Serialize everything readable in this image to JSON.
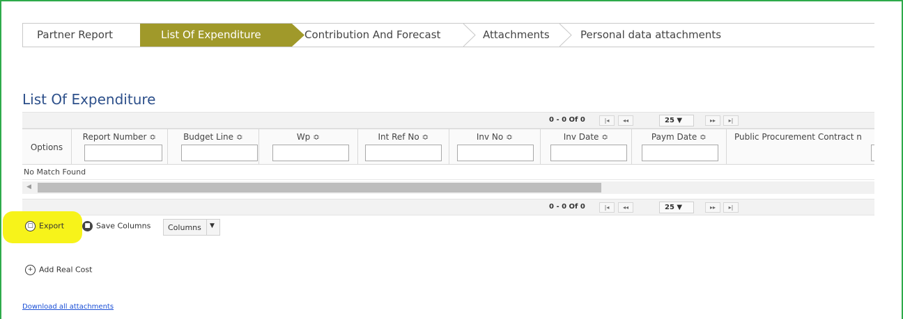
{
  "wizard": {
    "steps": [
      {
        "label": "Partner Report"
      },
      {
        "label": "List Of Expenditure"
      },
      {
        "label": "Contribution And Forecast"
      },
      {
        "label": "Attachments"
      },
      {
        "label": "Personal data attachments"
      }
    ],
    "active_index": 1,
    "active_color": "#a0992a"
  },
  "page_title": "List Of Expenditure",
  "paginator": {
    "count_text": "0 - 0 Of 0",
    "first_icon": "first-page-icon",
    "prev_icon": "prev-page-icon",
    "next_icon": "next-page-icon",
    "last_icon": "last-page-icon",
    "rows_per_page": "25 ▼"
  },
  "table": {
    "columns": [
      {
        "label": "Options"
      },
      {
        "label": "Report Number ≎"
      },
      {
        "label": "Budget Line ≎"
      },
      {
        "label": "Wp ≎"
      },
      {
        "label": "Int Ref No ≎"
      },
      {
        "label": "Inv No ≎"
      },
      {
        "label": "Inv Date ≎"
      },
      {
        "label": "Paym Date ≎"
      },
      {
        "label": "Public Procurement Contract n"
      }
    ],
    "empty_message": "No Match Found"
  },
  "actions": {
    "export_label": "Export",
    "save_columns_label": "Save Columns",
    "columns_label": "Columns",
    "add_real_cost_label": "Add Real Cost",
    "download_link": "Download all attachments"
  },
  "colors": {
    "frame": "#2eaa4a",
    "title": "#2c4f8a",
    "highlight": "#f7f31a",
    "link": "#1a4fd6"
  }
}
